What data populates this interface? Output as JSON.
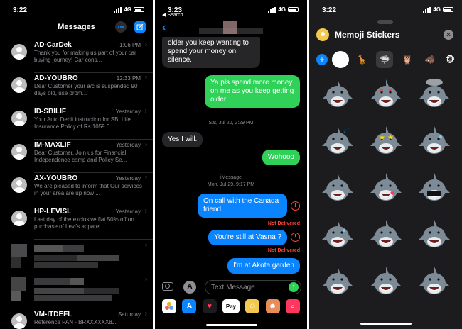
{
  "panel1": {
    "status": {
      "time": "3:22",
      "network": "4G"
    },
    "title": "Messages",
    "threads": [
      {
        "name": "AD-CarDek",
        "time": "1:06 PM",
        "preview": "Thank you for making us part of your car buying journey! Car cons..."
      },
      {
        "name": "AD-YOUBRO",
        "time": "12:33 PM",
        "preview": "Dear Customer your a/c is suspended 90 days old, use prom..."
      },
      {
        "name": "ID-SBILIF",
        "time": "Yesterday",
        "preview": "Your Auto Debit instruction for SBI Life Insurance Policy of Rs 1059.0..."
      },
      {
        "name": "IM-MAXLIF",
        "time": "Yesterday",
        "preview": "Dear Customer, Join us for Financial Independence camp and Policy Se..."
      },
      {
        "name": "AX-YOUBRO",
        "time": "Yesterday",
        "preview": "We are pleased to inform that Our services in your area are up now ..."
      },
      {
        "name": "HP-LEVISL",
        "time": "Yesterday",
        "preview": "Last day of the exclusive flat 50% off on purchase of Levi's apparel...."
      }
    ],
    "last_thread": {
      "name": "VM-ITDEFL",
      "time": "Saturday",
      "preview": "Reference PAN - BRXXXXXX8J."
    }
  },
  "panel2": {
    "status": {
      "time": "3:23",
      "network": "4G"
    },
    "back_label": "Search",
    "messages": {
      "partial": "older you keep wanting to spend your money on silence.",
      "green1": "Ya pls spend more money on me as you keep getting older",
      "ts1": "Sat, Jul 20, 2:29 PM",
      "in1": "Yes I will.",
      "green2": "Wohooo",
      "ts2_label": "iMessage",
      "ts2": "Mon, Jul 29, 9:17 PM",
      "blue1": "On call with the Canada friend",
      "nd1": "Not Delivered",
      "blue2": "You're still at Vasna ?",
      "nd2": "Not Delivered",
      "blue3": "I'm at Akota garden"
    },
    "composer": {
      "placeholder": "Text Message"
    },
    "appbar": [
      "Photos",
      "App Store",
      "Heart",
      "Pay",
      "Memoji",
      "Memoji Stickers",
      "Search"
    ]
  },
  "panel3": {
    "status": {
      "time": "3:22",
      "network": "4G"
    },
    "title": "Memoji Stickers",
    "sticker_count": 15,
    "colors": {
      "accent": "#0a84ff",
      "shark": "#7d8b96"
    }
  }
}
